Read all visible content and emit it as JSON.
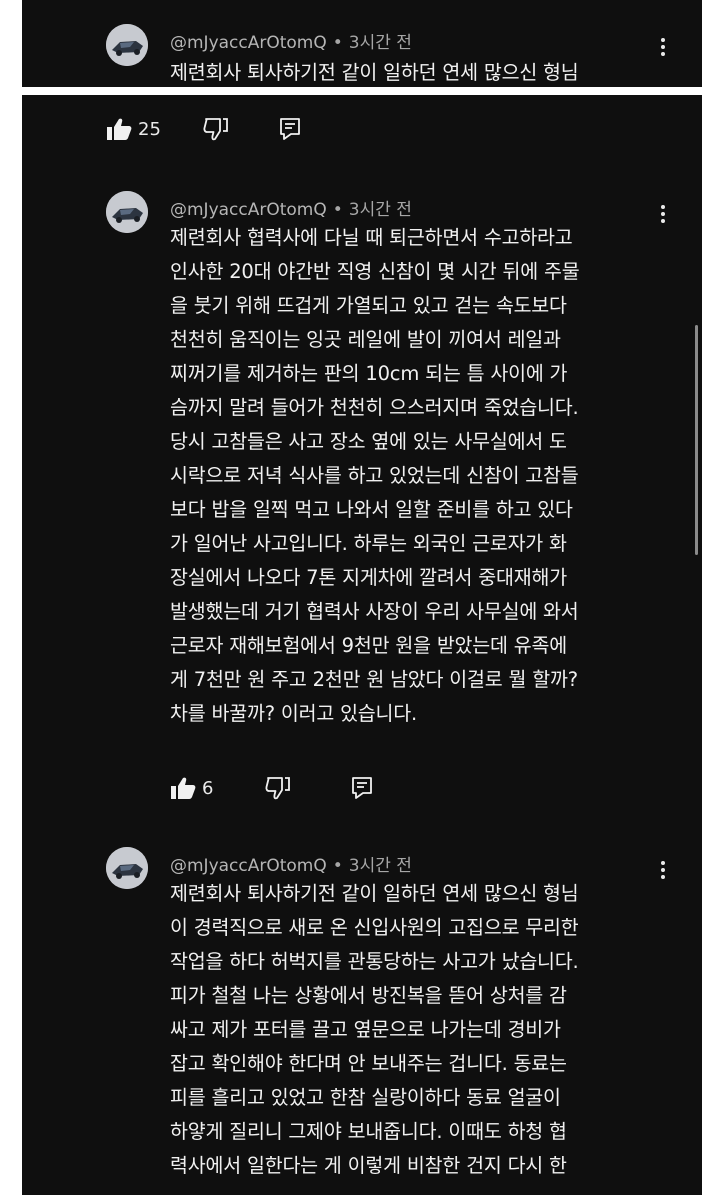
{
  "comments": [
    {
      "handle": "@mJyaccArOtomQ",
      "time": "3시간 전",
      "text": "제련회사 퇴사하기전 같이 일하던 연세 많으신 형님",
      "likes": "25"
    },
    {
      "handle": "@mJyaccArOtomQ",
      "time": "3시간 전",
      "text": "제련회사 협력사에 다닐 때 퇴근하면서 수고하라고\n인사한 20대 야간반 직영 신참이 몇 시간 뒤에 주물\n을 붓기 위해 뜨겁게 가열되고 있고 걷는 속도보다\n천천히 움직이는 잉곳 레일에 발이 끼여서 레일과\n찌꺼기를 제거하는 판의 10cm 되는 틈 사이에 가\n슴까지 말려 들어가 천천히 으스러지며 죽었습니다.\n당시 고참들은 사고 장소 옆에 있는 사무실에서 도\n시락으로 저녁 식사를 하고 있었는데 신참이 고참들\n보다 밥을 일찍 먹고 나와서 일할 준비를 하고 있다\n가 일어난 사고입니다. 하루는 외국인 근로자가 화\n장실에서 나오다 7톤 지게차에 깔려서 중대재해가\n발생했는데 거기 협력사 사장이 우리 사무실에 와서\n근로자 재해보험에서 9천만 원을 받았는데 유족에\n게 7천만 원 주고 2천만 원 남았다 이걸로 뭘 할까?\n차를 바꿀까? 이러고 있습니다.",
      "likes": "6"
    },
    {
      "handle": "@mJyaccArOtomQ",
      "time": "3시간 전",
      "text": "제련회사 퇴사하기전 같이 일하던 연세 많으신 형님\n이 경력직으로 새로 온 신입사원의 고집으로 무리한\n작업을 하다 허벅지를 관통당하는 사고가 났습니다.\n피가 철철 나는 상황에서 방진복을 뜯어 상처를 감\n싸고 제가 포터를 끌고 옆문으로 나가는데 경비가\n잡고 확인해야 한다며 안 보내주는 겁니다. 동료는\n피를 흘리고 있었고 한참 실랑이하다 동료 얼굴이\n하얗게 질리니 그제야 보내줍니다. 이때도 하청 협\n력사에서 일한다는 게 이렇게 비참한 건지 다시 한"
    }
  ],
  "icons": {
    "like": "thumbs-up-icon",
    "dislike": "thumbs-down-icon",
    "reply": "reply-icon",
    "menu": "more-vertical-icon"
  },
  "colors": {
    "background": "#0f0f0f",
    "text": "#f1f1f1",
    "meta": "#a6a6a6"
  }
}
